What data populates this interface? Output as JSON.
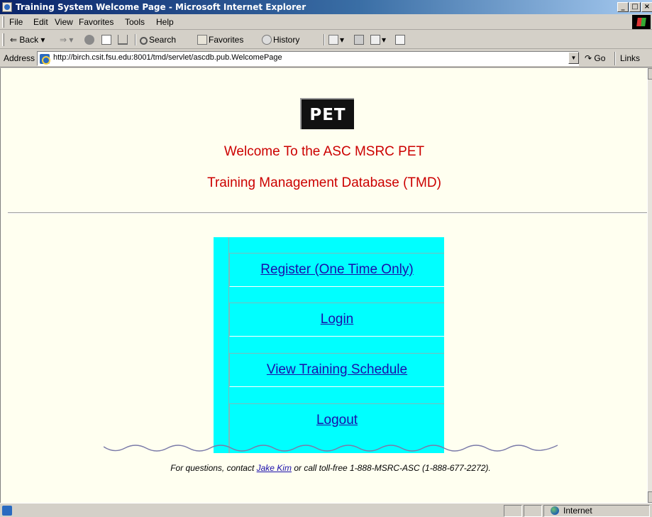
{
  "window": {
    "title": "Training System Welcome Page - Microsoft Internet Explorer",
    "controls": {
      "minimize": "_",
      "maximize": "□",
      "close": "×"
    }
  },
  "menubar": {
    "items": [
      "File",
      "Edit",
      "View",
      "Favorites",
      "Tools",
      "Help"
    ]
  },
  "toolbar": {
    "back": "Back",
    "search": "Search",
    "favorites": "Favorites",
    "history": "History"
  },
  "addressbar": {
    "label": "Address",
    "url": "http://birch.csit.fsu.edu:8001/tmd/servlet/ascdb.pub.WelcomePage",
    "go": "Go",
    "links": "Links"
  },
  "page": {
    "logo_text": "PET",
    "heading1": "Welcome To the ASC MSRC PET",
    "heading2": "Training Management Database (TMD)",
    "menu": [
      {
        "label": "Register (One Time Only)"
      },
      {
        "label": "Login"
      },
      {
        "label": "View Training Schedule"
      },
      {
        "label": "Logout"
      }
    ],
    "footer": {
      "prefix": "For questions, contact ",
      "contact_name": "Jake Kim",
      "suffix": " or call toll-free 1-888-MSRC-ASC (1-888-677-2272)."
    }
  },
  "statusbar": {
    "zone": "Internet"
  },
  "colors": {
    "heading": "#cc0000",
    "menu_bg": "#00ffff",
    "link": "#1a0eab",
    "page_bg": "#fffff0"
  }
}
